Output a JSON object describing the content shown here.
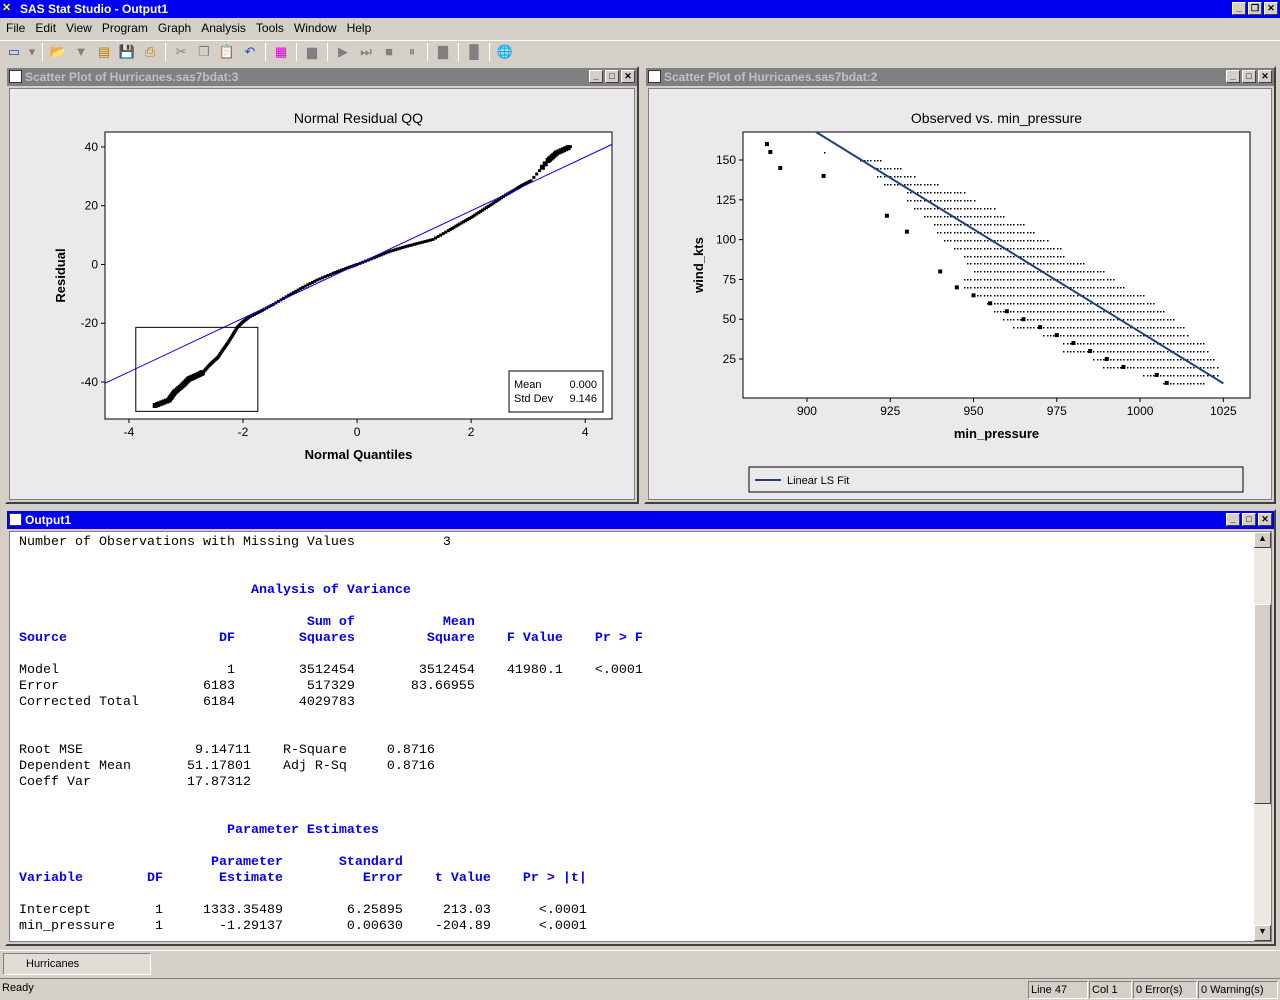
{
  "app": {
    "title": "SAS Stat Studio - Output1"
  },
  "menu": [
    "File",
    "Edit",
    "View",
    "Program",
    "Graph",
    "Analysis",
    "Tools",
    "Window",
    "Help"
  ],
  "toolbar_icons": [
    "new-icon",
    "dropdown-icon",
    "sep",
    "open-icon",
    "filter-icon",
    "cabinet-icon",
    "save-icon",
    "print-icon",
    "sep",
    "cut-icon",
    "copy-icon",
    "paste-icon",
    "undo-icon",
    "sep",
    "grid-icon",
    "sep",
    "page-icon",
    "sep",
    "run-icon",
    "step-icon",
    "stop-icon",
    "pause-icon",
    "sep",
    "block-icon",
    "sep",
    "block2-icon",
    "sep",
    "web-icon"
  ],
  "windows": {
    "qq": {
      "title": "Scatter Plot of Hurricanes.sas7bdat:3"
    },
    "scatter": {
      "title": "Scatter Plot of Hurricanes.sas7bdat:2"
    },
    "output": {
      "title": "Output1"
    }
  },
  "chart_data": [
    {
      "type": "scatter",
      "title": "Normal Residual QQ",
      "xlabel": "Normal Quantiles",
      "ylabel": "Residual",
      "xlim": [
        -4.42,
        4.47
      ],
      "ylim": [
        -52.6,
        45.1
      ],
      "xticks": [
        -4,
        -2,
        0,
        2,
        4
      ],
      "yticks": [
        -40,
        -20,
        0,
        20,
        40
      ],
      "fit_line": {
        "slope": 9.146,
        "intercept": 0,
        "color": "#0000ff"
      },
      "points": [
        [
          -3.54,
          -48
        ],
        [
          -3.3,
          -46.2
        ],
        [
          -3.2,
          -43.5
        ],
        [
          -3.05,
          -41
        ],
        [
          -2.95,
          -39
        ],
        [
          -2.88,
          -38.4
        ],
        [
          -2.78,
          -37.5
        ],
        [
          -2.7,
          -36.7
        ],
        [
          -2.6,
          -34.5
        ],
        [
          -2.52,
          -33
        ],
        [
          -2.44,
          -31.6
        ],
        [
          -2.35,
          -29
        ],
        [
          -2.26,
          -26.5
        ],
        [
          -2.18,
          -24
        ],
        [
          -2.1,
          -21.4
        ],
        [
          -2.0,
          -19.5
        ],
        [
          -1.9,
          -18
        ],
        [
          -1.7,
          -16
        ],
        [
          -1.47,
          -13.6
        ],
        [
          -1.2,
          -10.5
        ],
        [
          -0.95,
          -7.8
        ],
        [
          -0.7,
          -5.3
        ],
        [
          -0.42,
          -3
        ],
        [
          -0.2,
          -1.4
        ],
        [
          0,
          0
        ],
        [
          0.3,
          2.3
        ],
        [
          0.55,
          4.3
        ],
        [
          0.8,
          5.8
        ],
        [
          1.05,
          7.1
        ],
        [
          1.33,
          8.5
        ],
        [
          1.6,
          11.5
        ],
        [
          1.8,
          13.8
        ],
        [
          2.0,
          16
        ],
        [
          2.2,
          18.5
        ],
        [
          2.4,
          21
        ],
        [
          2.6,
          23.6
        ],
        [
          2.8,
          25.8
        ],
        [
          2.9,
          27
        ],
        [
          3.05,
          28.5
        ],
        [
          3.35,
          35.4
        ],
        [
          3.5,
          38
        ],
        [
          3.74,
          40.1
        ]
      ],
      "highlight_box": {
        "x": [
          -3.88,
          -1.74
        ],
        "y": [
          -50,
          -21.4
        ]
      },
      "stats": [
        {
          "label": "Mean",
          "value": "0.000"
        },
        {
          "label": "Std Dev",
          "value": "9.146"
        }
      ]
    },
    {
      "type": "scatter",
      "title": "Observed vs. min_pressure",
      "xlabel": "min_pressure",
      "ylabel": "wind_kts",
      "xlim": [
        880.8,
        1033
      ],
      "ylim": [
        0.5,
        167.6
      ],
      "xticks": [
        900,
        925,
        950,
        975,
        1000,
        1025
      ],
      "yticks": [
        25,
        50,
        75,
        100,
        125,
        150
      ],
      "fit_line": {
        "slope": -1.29137,
        "intercept": 1333.35489,
        "color": "#1f3f7f",
        "name": "Linear LS Fit"
      },
      "point_bands": [
        [
          155,
          905,
          905
        ],
        [
          150,
          916,
          922
        ],
        [
          145,
          920,
          928
        ],
        [
          140,
          921,
          932
        ],
        [
          135,
          923,
          939
        ],
        [
          130,
          930,
          947
        ],
        [
          125,
          930,
          950
        ],
        [
          120,
          932,
          956
        ],
        [
          115,
          935,
          959
        ],
        [
          110,
          938,
          965
        ],
        [
          105,
          939,
          968
        ],
        [
          100,
          941,
          972
        ],
        [
          95,
          944,
          976
        ],
        [
          90,
          947,
          977
        ],
        [
          85,
          948,
          983
        ],
        [
          80,
          950,
          989
        ],
        [
          75,
          947,
          992
        ],
        [
          70,
          947,
          995
        ],
        [
          65,
          950,
          1001
        ],
        [
          60,
          954,
          1004
        ],
        [
          55,
          956,
          1007
        ],
        [
          50,
          959,
          1010
        ],
        [
          45,
          962,
          1013
        ],
        [
          40,
          971,
          1014
        ],
        [
          35,
          977,
          1019
        ],
        [
          30,
          977,
          1020
        ],
        [
          25,
          986,
          1022
        ],
        [
          20,
          989,
          1023
        ],
        [
          15,
          1001,
          1023
        ],
        [
          10,
          1007,
          1019
        ]
      ],
      "heavy_points": [
        [
          888,
          160
        ],
        [
          889,
          155
        ],
        [
          892,
          145
        ],
        [
          905,
          140
        ],
        [
          924,
          115
        ],
        [
          930,
          105
        ],
        [
          950,
          65
        ],
        [
          955,
          60
        ],
        [
          960,
          55
        ],
        [
          965,
          50
        ],
        [
          970,
          45
        ],
        [
          975,
          40
        ],
        [
          980,
          35
        ],
        [
          985,
          30
        ],
        [
          990,
          25
        ],
        [
          995,
          20
        ],
        [
          1005,
          15
        ],
        [
          1008,
          10
        ],
        [
          940,
          80
        ],
        [
          945,
          70
        ]
      ]
    }
  ],
  "output": {
    "lines": [
      {
        "t": "Number of Observations with Missing Values           3",
        "h": false
      },
      {
        "t": "",
        "h": false
      },
      {
        "t": "",
        "h": false
      },
      {
        "t": "                             Analysis of Variance",
        "h": true
      },
      {
        "t": "",
        "h": false
      },
      {
        "t": "                                    Sum of           Mean",
        "h": true
      },
      {
        "t": "Source                   DF        Squares         Square    F Value    Pr > F",
        "h": true
      },
      {
        "t": "",
        "h": false
      },
      {
        "t": "Model                     1        3512454        3512454    41980.1    <.0001",
        "h": false
      },
      {
        "t": "Error                  6183         517329       83.66955",
        "h": false
      },
      {
        "t": "Corrected Total        6184        4029783",
        "h": false
      },
      {
        "t": "",
        "h": false
      },
      {
        "t": "",
        "h": false
      },
      {
        "t": "Root MSE              9.14711    R-Square     0.8716",
        "h": false
      },
      {
        "t": "Dependent Mean       51.17801    Adj R-Sq     0.8716",
        "h": false
      },
      {
        "t": "Coeff Var            17.87312",
        "h": false
      },
      {
        "t": "",
        "h": false
      },
      {
        "t": "",
        "h": false
      },
      {
        "t": "                          Parameter Estimates",
        "h": true
      },
      {
        "t": "",
        "h": false
      },
      {
        "t": "                        Parameter       Standard",
        "h": true
      },
      {
        "t": "Variable        DF       Estimate          Error    t Value    Pr > |t|",
        "h": true
      },
      {
        "t": "",
        "h": false
      },
      {
        "t": "Intercept        1     1333.35489        6.25895     213.03      <.0001",
        "h": false
      },
      {
        "t": "min_pressure     1       -1.29137        0.00630    -204.89      <.0001",
        "h": false
      }
    ]
  },
  "tabs": [
    "Hurricanes"
  ],
  "status": {
    "ready": "Ready",
    "line": "Line 47",
    "col": "Col 1",
    "errors": "0 Error(s)",
    "warnings": "0 Warning(s)"
  }
}
